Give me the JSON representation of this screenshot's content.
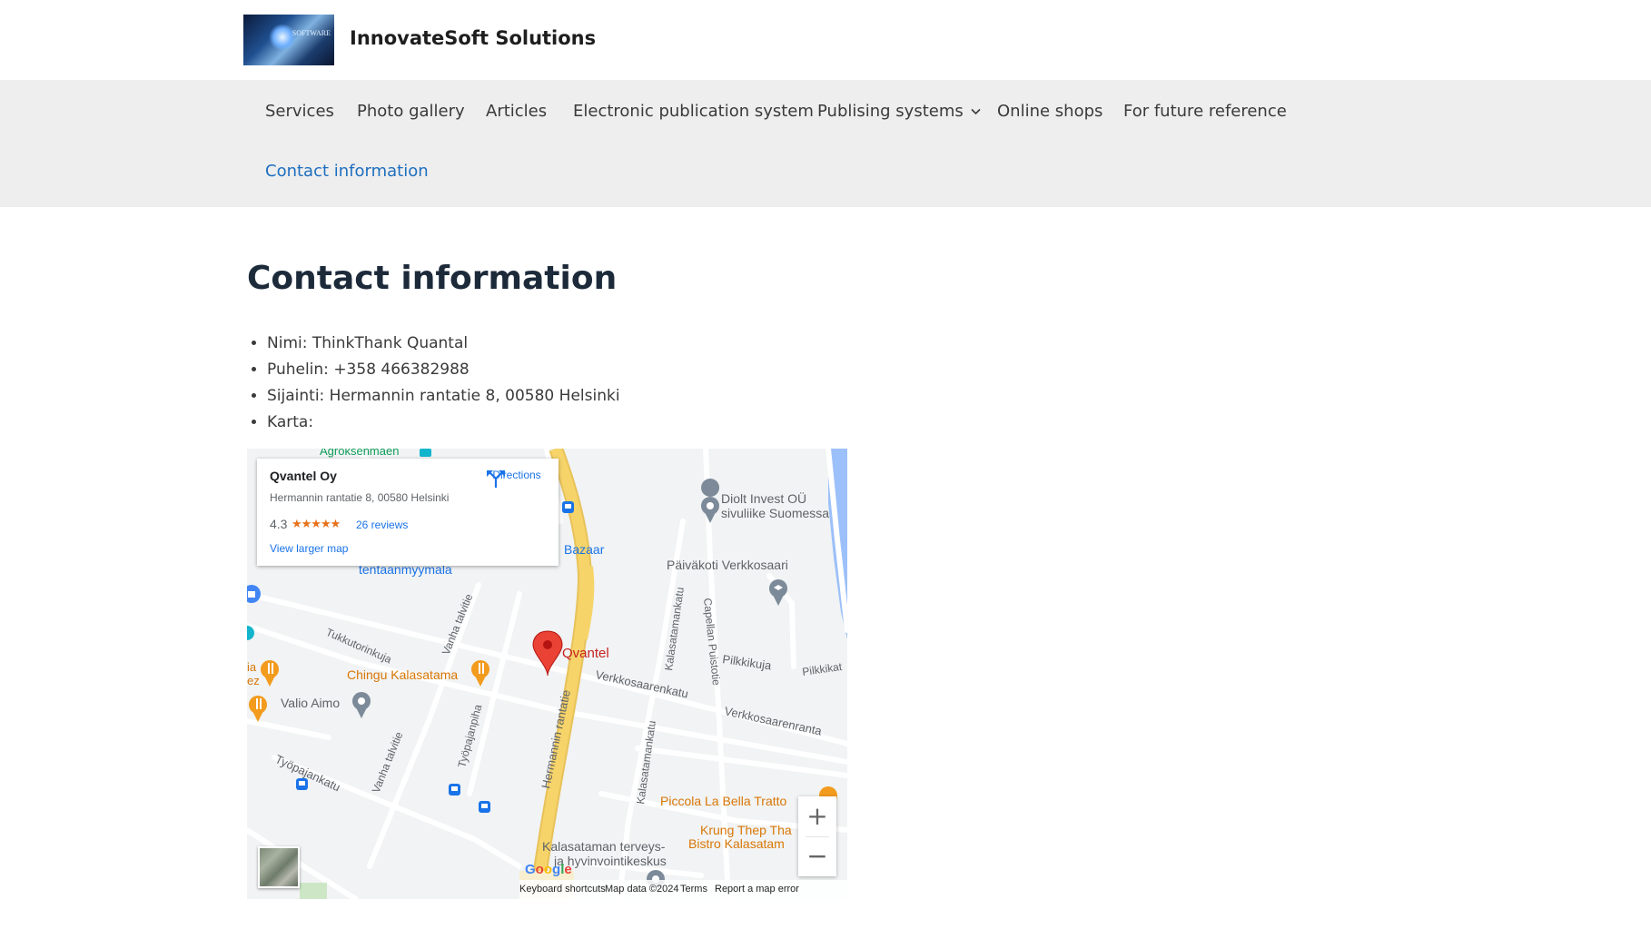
{
  "site": {
    "title": "InnovateSoft Solutions",
    "logo_text": "SOFTWARE"
  },
  "nav": {
    "items": [
      {
        "label": "Services"
      },
      {
        "label": "Photo gallery"
      },
      {
        "label": "Articles"
      },
      {
        "label": "Electronic publication system"
      },
      {
        "label": "Publising systems"
      },
      {
        "label": "Online shops"
      },
      {
        "label": "For future reference"
      },
      {
        "label": "Contact information"
      }
    ],
    "active_color": "#1e6fbf"
  },
  "page": {
    "title": "Contact information",
    "info": [
      "Nimi: ThinkThank Quantal",
      "Puhelin: +358 466382988",
      "Sijainti: Hermannin rantatie 8, 00580 Helsinki",
      "Karta:"
    ]
  },
  "map": {
    "card": {
      "name": "Qvantel Oy",
      "address": "Hermannin rantatie 8, 00580 Helsinki",
      "rating": "4.3",
      "stars": "★★★★★",
      "reviews": "26 reviews",
      "larger_map": "View larger map",
      "directions": "Directions"
    },
    "labels": {
      "agroksenmaen": "Agroksenmäen",
      "diolt1": "Diolt Invest OÜ",
      "diolt2": "sivuliike Suomessa",
      "bazaar": "Bazaar",
      "tentaanmyymala": "tentaanmyymala",
      "paivakoti": "Päiväkoti Verkkosaari",
      "tukkutori": "Tukkutorinkuja",
      "vanha1": "Vanha talvitie",
      "vanha2": "Vanha talvitie",
      "qvantel": "Qvantel",
      "chingu": "Chingu Kalasatama",
      "kalasatamankatu1": "Kalasatamankatu",
      "kalasatamankatu2": "Kalasatamankatu",
      "capellan": "Capellan Puistotie",
      "pilkkikuja": "Pilkkikuja",
      "pilkkikatu": "Pilkkikat",
      "verkkosaarenkatu": "Verkkosaarenkatu",
      "verkkosaarenranta": "Verkkosaarenranta",
      "valio": "Valio Aimo",
      "tyopajankatu": "Työpajankatu",
      "tyopajanpiha": "Työpajanpiha",
      "hermannin": "Hermannin rantatie",
      "piccola": "Piccola La Bella Tratto",
      "krung1": "Krung Thep Tha",
      "krung2": "Bistro Kalasatam",
      "terveys1": "Kalasataman terveys-",
      "terveys2": "ja hyvinvointikeskus",
      "edge_ia": "ia",
      "edge_ez": "ez"
    },
    "zoom_in": "+",
    "zoom_out": "−",
    "google": "Google",
    "attribution": {
      "shortcuts": "Keyboard shortcuts",
      "data": "Map data ©2024",
      "terms": "Terms",
      "report": "Report a map error"
    },
    "colors": {
      "road_major": "#f6d46a",
      "water": "#9cc0f9",
      "pin": "#ea4335",
      "poi_food": "#f29b1d",
      "poi_label_food": "#d97706",
      "poi_label_blue": "#1a73e8"
    }
  }
}
